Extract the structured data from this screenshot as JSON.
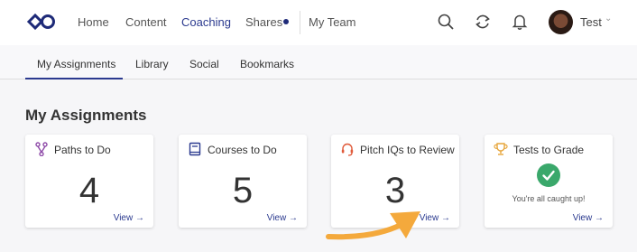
{
  "nav": {
    "items": [
      {
        "label": "Home"
      },
      {
        "label": "Content"
      },
      {
        "label": "Coaching"
      },
      {
        "label": "Shares"
      },
      {
        "label": "My Team"
      }
    ],
    "user_name": "Test",
    "icons": [
      "search-icon",
      "sync-icon",
      "bell-icon"
    ]
  },
  "tabs": [
    {
      "label": "My Assignments"
    },
    {
      "label": "Library"
    },
    {
      "label": "Social"
    },
    {
      "label": "Bookmarks"
    }
  ],
  "page": {
    "title": "My Assignments"
  },
  "cards": [
    {
      "title": "Paths to Do",
      "count": "4",
      "link": "View →",
      "icon": "path-icon"
    },
    {
      "title": "Courses to Do",
      "count": "5",
      "link": "View →",
      "icon": "book-icon"
    },
    {
      "title": "Pitch IQs to Review",
      "count": "3",
      "link": "View →",
      "icon": "headset-icon"
    },
    {
      "title": "Tests to Grade",
      "status": "You're all caught up!",
      "link": "View →",
      "icon": "trophy-icon"
    }
  ],
  "colors": {
    "brand": "#2b3a8f",
    "accent_icon": "#8e4aa8",
    "pitch_icon": "#e05a3a",
    "trophy_icon": "#e6a53a",
    "success": "#3aa86b",
    "annotation_arrow": "#f4a93c"
  }
}
